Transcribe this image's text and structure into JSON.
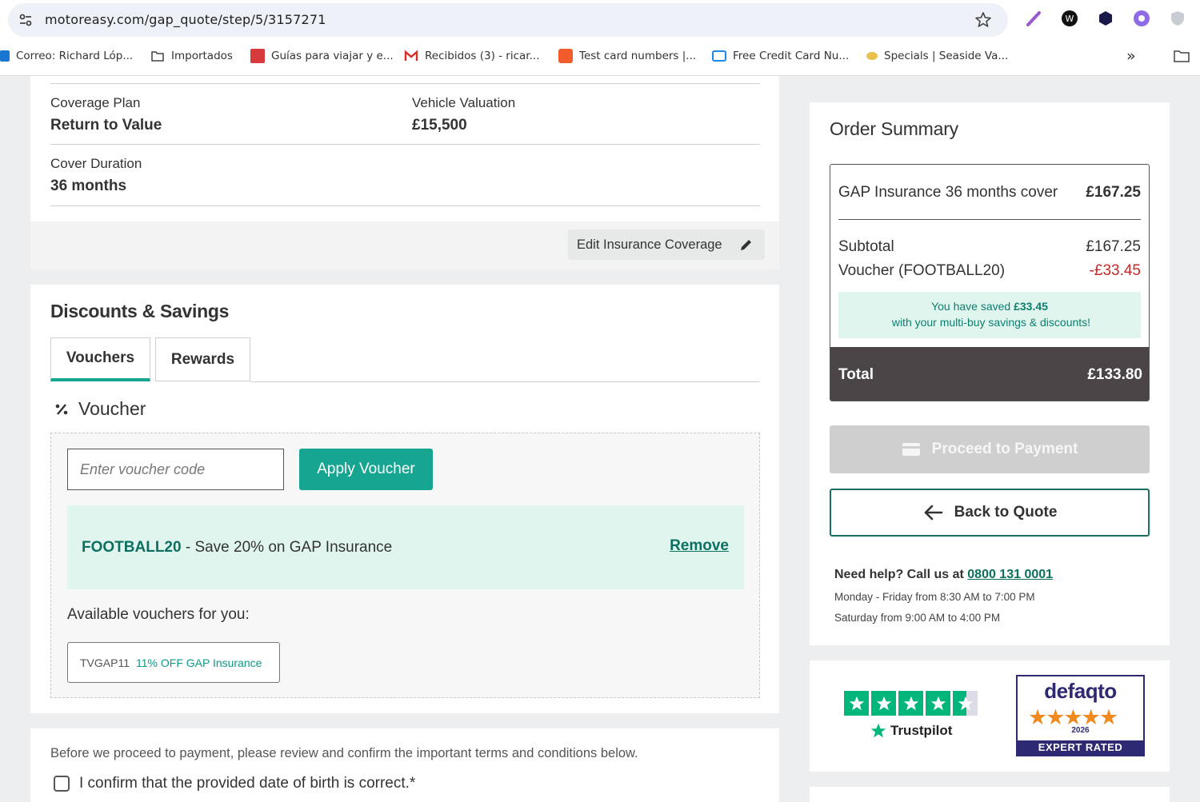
{
  "browser": {
    "url": "motoreasy.com/gap_quote/step/5/3157271",
    "bookmarks": [
      "Correo: Richard Lóp...",
      "Importados",
      "Guías para viajar y e...",
      "Recibidos (3) - ricar...",
      "Test card numbers |...",
      "Free Credit Card Nu...",
      "Specials | Seaside Va..."
    ],
    "more": "»"
  },
  "coverage": {
    "plan_label": "Coverage Plan",
    "plan_value": "Return to Value",
    "valuation_label": "Vehicle Valuation",
    "valuation_value": "£15,500",
    "duration_label": "Cover Duration",
    "duration_value": "36 months",
    "edit_label": "Edit Insurance Coverage"
  },
  "discounts": {
    "title": "Discounts & Savings",
    "tabs": [
      "Vouchers",
      "Rewards"
    ],
    "voucher_heading": "Voucher",
    "input_placeholder": "Enter voucher code",
    "apply_label": "Apply Voucher",
    "applied_code": "FOOTBALL20",
    "applied_desc": " - Save 20% on GAP Insurance",
    "remove_label": "Remove",
    "available_label": "Available vouchers for you:",
    "available": [
      {
        "code": "TVGAP11",
        "desc": "11% OFF GAP Insurance"
      }
    ]
  },
  "terms": {
    "intro": "Before we proceed to payment, please review and confirm the important terms and conditions below.",
    "confirm_dob": "I confirm that the provided date of birth is correct.*"
  },
  "order_summary": {
    "title": "Order Summary",
    "item_label": "GAP Insurance 36 months cover",
    "item_price": "£167.25",
    "subtotal_label": "Subtotal",
    "subtotal_value": "£167.25",
    "voucher_label": "Voucher (FOOTBALL20)",
    "voucher_value": "-£33.45",
    "saved_pre": "You have saved ",
    "saved_amount": "£33.45",
    "saved_post": " with your multi-buy savings & discounts!",
    "total_label": "Total",
    "total_value": "£133.80",
    "pay_label": "Proceed to Payment",
    "back_label": "Back to Quote",
    "help_pre": "Need help? Call us at ",
    "help_phone": "0800 131 0001",
    "hours_weekday": "Monday - Friday from 8:30 AM to 7:00 PM",
    "hours_saturday": "Saturday from 9:00 AM to 4:00 PM"
  },
  "ratings": {
    "trustpilot": "Trustpilot",
    "defaqto_name": "defaqto",
    "defaqto_year": "2026",
    "defaqto_band": "EXPERT RATED"
  },
  "colors": {
    "brand_teal": "#16a591",
    "dark_teal": "#0d6f5f",
    "total_bar": "#4b4547",
    "negative": "#c62828",
    "trustpilot_green": "#00b67a",
    "defaqto_navy": "#2d2a73"
  }
}
